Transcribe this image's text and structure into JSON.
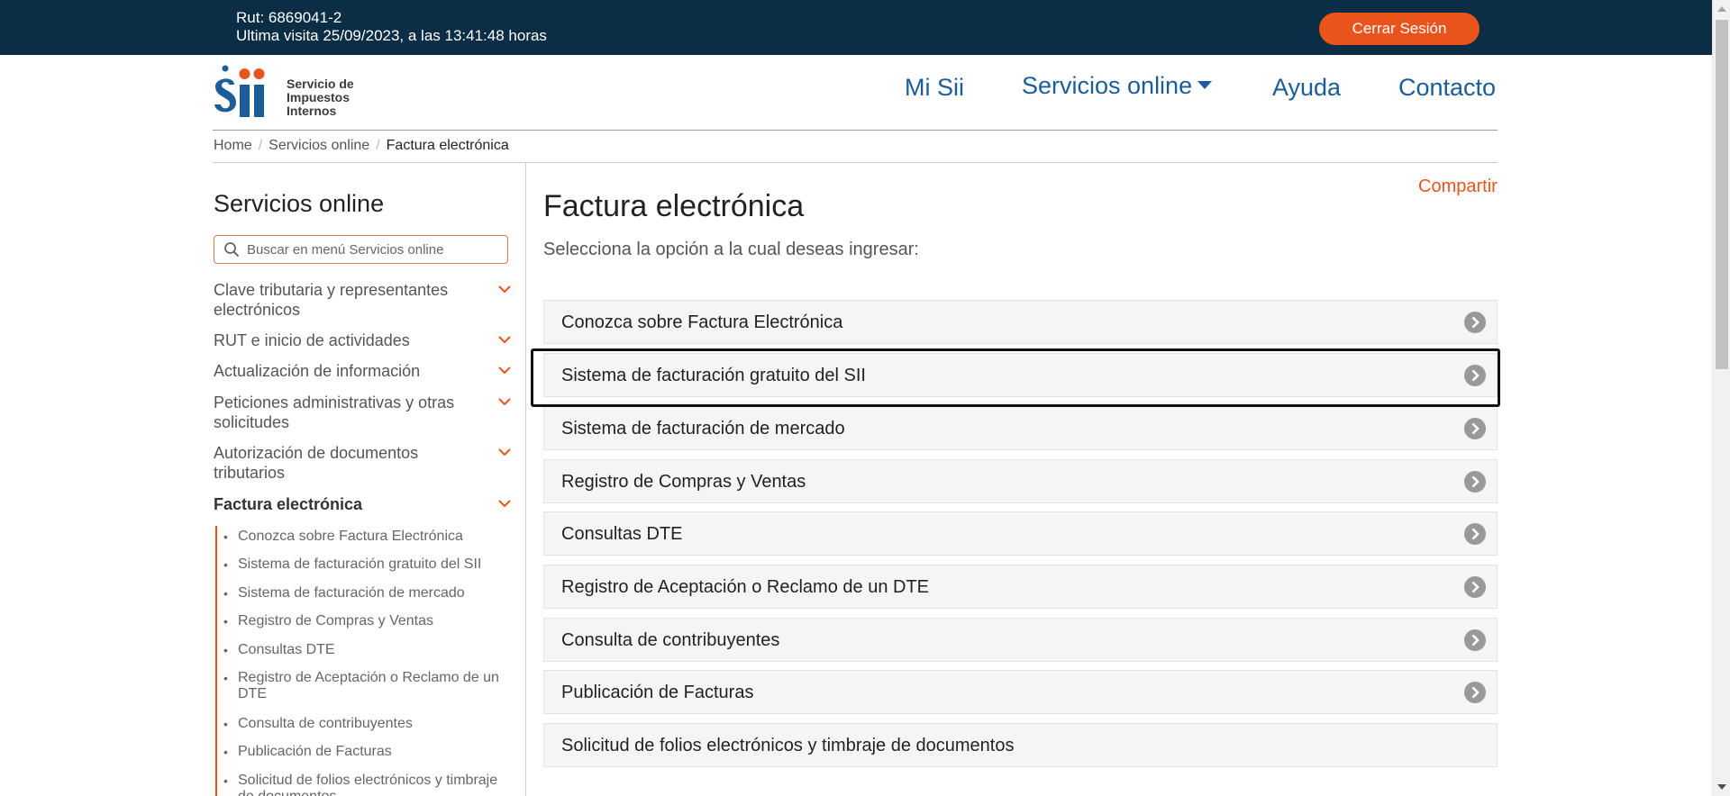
{
  "topbar": {
    "rut": "Rut: 6869041-2",
    "last_visit": "Ultima visita 25/09/2023, a las 13:41:48 horas",
    "logout_label": "Cerrar Sesión"
  },
  "logo": {
    "lines": [
      "Servicio de",
      "Impuestos",
      "Internos"
    ],
    "icon": "sii-logo-icon"
  },
  "nav": {
    "items": [
      {
        "label": "Mi Sii"
      },
      {
        "label": "Servicios online",
        "icon": "caret-down-icon"
      },
      {
        "label": "Ayuda"
      },
      {
        "label": "Contacto"
      }
    ]
  },
  "breadcrumb": {
    "items": [
      "Home",
      "Servicios online"
    ],
    "current": "Factura electrónica"
  },
  "sidebar": {
    "title": "Servicios online",
    "search_placeholder": "Buscar en menú Servicios online",
    "items": [
      {
        "label": "Clave tributaria y representantes electrónicos"
      },
      {
        "label": "RUT e inicio de actividades"
      },
      {
        "label": "Actualización de información"
      },
      {
        "label": "Peticiones administrativas y otras solicitudes"
      },
      {
        "label": "Autorización de documentos tributarios"
      },
      {
        "label": "Factura electrónica",
        "active": true
      }
    ],
    "subitems": [
      "Conozca sobre Factura Electrónica",
      "Sistema de facturación gratuito del SII",
      "Sistema de facturación de mercado",
      "Registro de Compras y Ventas",
      "Consultas DTE",
      "Registro de Aceptación o Reclamo de un DTE",
      "Consulta de contribuyentes",
      "Publicación de Facturas",
      "Solicitud de folios electrónicos y timbraje de documentos"
    ]
  },
  "main": {
    "title": "Factura electrónica",
    "share_label": "Compartir",
    "subtitle": "Selecciona la opción a la cual deseas ingresar:",
    "options": [
      {
        "label": "Conozca sobre Factura Electrónica",
        "has_arrow": true
      },
      {
        "label": "Sistema de facturación gratuito del SII",
        "has_arrow": true,
        "highlighted": true
      },
      {
        "label": "Sistema de facturación de mercado",
        "has_arrow": true
      },
      {
        "label": "Registro de Compras y Ventas",
        "has_arrow": true
      },
      {
        "label": "Consultas DTE",
        "has_arrow": true
      },
      {
        "label": "Registro de Aceptación o Reclamo de un DTE",
        "has_arrow": true
      },
      {
        "label": "Consulta de contribuyentes",
        "has_arrow": true
      },
      {
        "label": "Publicación de Facturas",
        "has_arrow": true
      },
      {
        "label": "Solicitud de folios electrónicos y timbraje de documentos",
        "has_arrow": false
      }
    ]
  },
  "colors": {
    "topbar_bg": "#0c2d46",
    "accent_orange": "#e8541c",
    "nav_blue": "#1b5d99",
    "option_bg": "#f5f5f5"
  }
}
